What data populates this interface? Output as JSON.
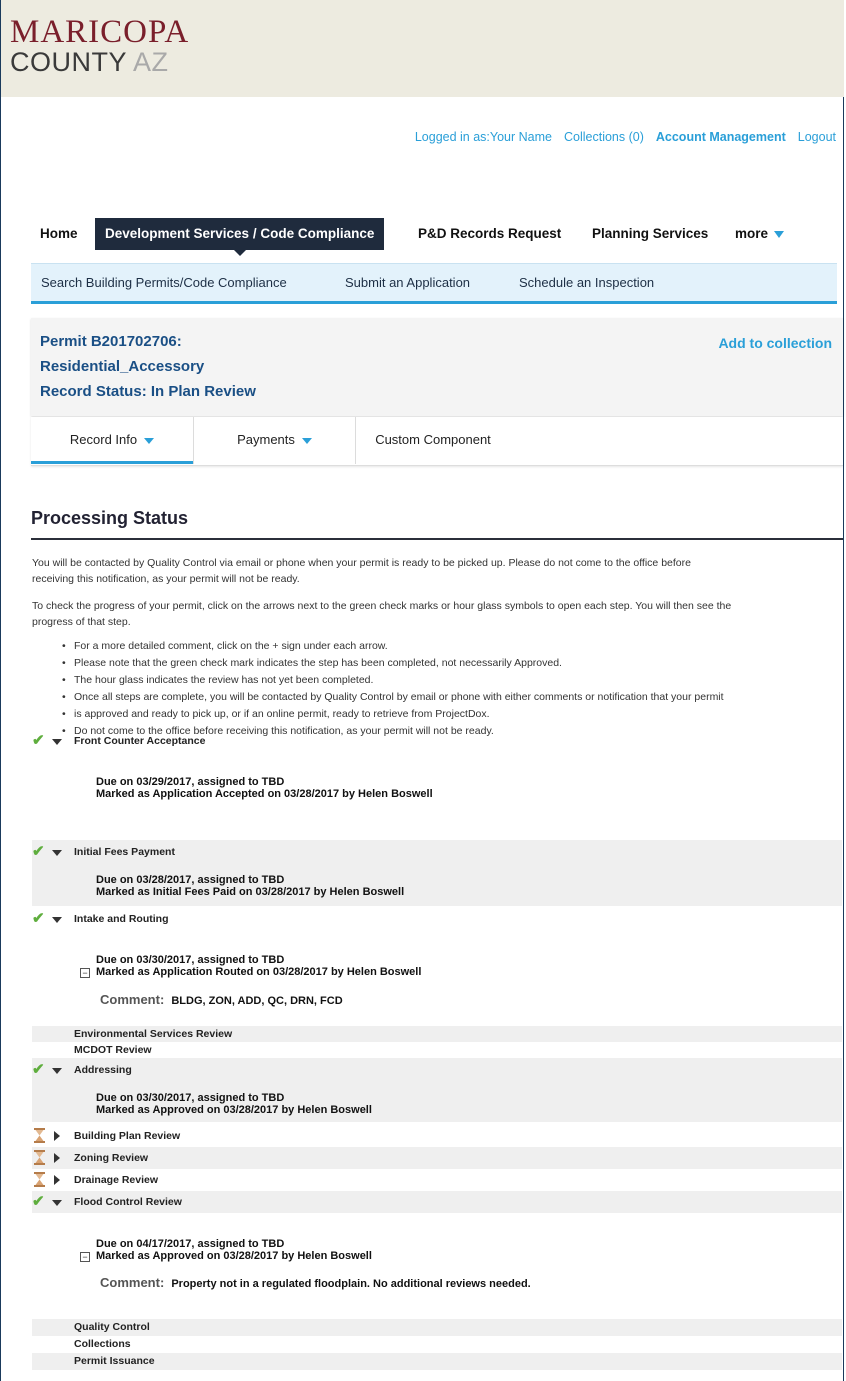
{
  "header": {
    "logo_line1": "MARICOPA",
    "logo_line2": "COUNTY",
    "logo_az": "AZ"
  },
  "top_links": {
    "logged_in": "Logged in as:Your Name",
    "collections": "Collections (0)",
    "account": "Account Management",
    "logout": "Logout"
  },
  "main_nav": {
    "home": "Home",
    "dev_services": "Development Services / Code Compliance",
    "records": "P&D Records Request",
    "planning": "Planning Services",
    "more": "more"
  },
  "sub_nav": {
    "search": "Search Building Permits/Code Compliance",
    "submit": "Submit an Application",
    "schedule": "Schedule an Inspection"
  },
  "permit": {
    "line1": "Permit B201702706:",
    "line2": "Residential_Accessory",
    "line3": "Record Status: In Plan Review",
    "add_collection": "Add to collection"
  },
  "tabs": {
    "record_info": "Record Info",
    "payments": "Payments",
    "custom": "Custom Component"
  },
  "processing": {
    "title": "Processing Status",
    "para1a": "You will be contacted by Quality Control via email or phone when your permit is ready to be picked up. Please do not come to the office before",
    "para1b": "receiving this notification, as your permit will not be ready.",
    "para2a": "To check the progress of your permit, click on the arrows next to the green check marks or hour glass symbols to open each step. You will then see the",
    "para2b": "progress of that step.",
    "bullets": [
      "For a more detailed comment, click on the + sign under each arrow.",
      "Please note that the green check mark indicates the step has been completed, not necessarily Approved.",
      "The hour glass indicates the review has not yet been completed.",
      "Once all steps are complete, you will be contacted by Quality Control by email or phone with either comments or notification that your permit",
      "is approved and ready to pick up, or if an online permit, ready to retrieve from ProjectDox.",
      "Do not come to the office before receiving this notification, as your permit will not be ready."
    ]
  },
  "steps": {
    "s1": {
      "name": "Front Counter Acceptance",
      "due": "Due on 03/29/2017, assigned to TBD",
      "marked": "Marked as Application Accepted on 03/28/2017 by Helen Boswell"
    },
    "s2": {
      "name": "Initial Fees Payment",
      "due": "Due on 03/28/2017, assigned to TBD",
      "marked": "Marked as Initial Fees Paid on 03/28/2017 by Helen Boswell"
    },
    "s3": {
      "name": "Intake and Routing",
      "due": "Due on 03/30/2017, assigned to TBD",
      "marked": "Marked as Application Routed on 03/28/2017 by Helen Boswell",
      "comment_label": "Comment:",
      "comment": "BLDG, ZON, ADD, QC, DRN, FCD"
    },
    "env": "Environmental Services Review",
    "mcdot": "MCDOT Review",
    "s4": {
      "name": "Addressing",
      "due": "Due on 03/30/2017, assigned to TBD",
      "marked": "Marked as Approved on 03/28/2017 by Helen Boswell"
    },
    "h1": "Building Plan Review",
    "h2": "Zoning Review",
    "h3": "Drainage Review",
    "s5": {
      "name": "Flood Control Review",
      "due": "Due on 04/17/2017, assigned to TBD",
      "marked": "Marked as Approved on 03/28/2017 by Helen Boswell",
      "comment_label": "Comment:",
      "comment": "Property not in a regulated floodplain. No additional reviews needed."
    },
    "qc": "Quality Control",
    "collections": "Collections",
    "issuance": "Permit Issuance"
  },
  "colors": {
    "accent": "#2a9fd8",
    "nav_dark": "#1f2b3d",
    "check": "#5fae3e",
    "brand": "#7a1f2b"
  }
}
